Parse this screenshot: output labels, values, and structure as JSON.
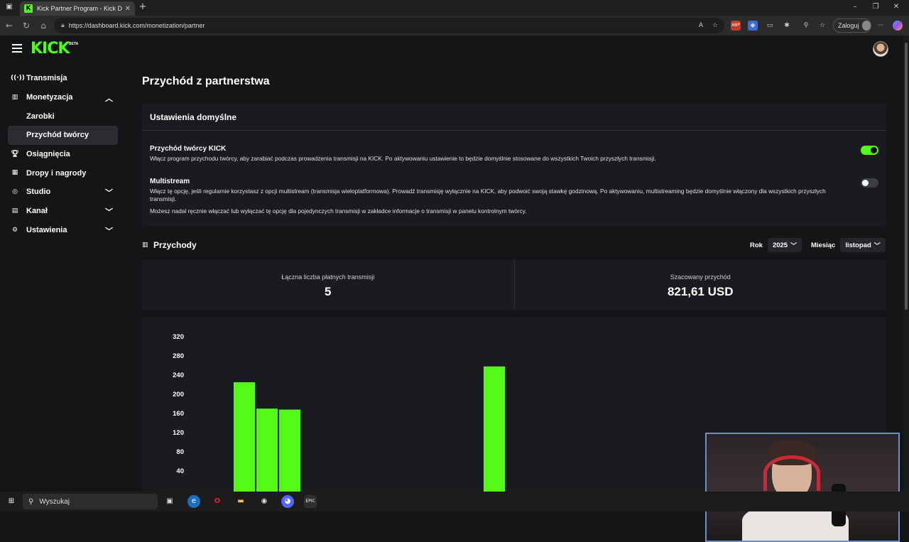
{
  "browser": {
    "tab_title": "Kick Partner Program - Kick Dash",
    "url": "https://dashboard.kick.com/monetization/partner",
    "login_label": "Zaloguj"
  },
  "app": {
    "logo": "KICK",
    "beta": "BETA"
  },
  "sidebar": {
    "items": [
      {
        "label": "Transmisja",
        "icon": "broadcast-icon"
      },
      {
        "label": "Monetyzacja",
        "icon": "chart-icon",
        "expanded": true
      },
      {
        "label": "Osiągnięcia",
        "icon": "trophy-icon"
      },
      {
        "label": "Dropy i nagrody",
        "icon": "gift-icon"
      },
      {
        "label": "Studio",
        "icon": "studio-icon"
      },
      {
        "label": "Kanał",
        "icon": "channel-icon"
      },
      {
        "label": "Ustawienia",
        "icon": "gear-icon"
      }
    ],
    "sub_items": [
      {
        "label": "Zarobki"
      },
      {
        "label": "Przychód twórcy",
        "active": true
      }
    ]
  },
  "main": {
    "title": "Przychód z partnerstwa",
    "settings_card": {
      "header": "Ustawienia domyślne",
      "creator_revenue": {
        "title": "Przychód twórcy KICK",
        "desc": "Włącz program przychodu twórcy, aby zarabiać podczas prowadzenia transmisji na KICK. Po aktywowaniu ustawienie to będzie domyślnie stosowane do wszystkich Twoich przyszłych transmisji.",
        "enabled": true
      },
      "multistream": {
        "title": "Multistream",
        "desc": "Włącz tę opcję, jeśli regularnie korzystasz z opcji multistream (transmisja wieloplatformowa). Prowadź transmisję wyłącznie na KICK, aby podwoić swoją stawkę godzinową. Po aktywowaniu, multistreaming będzie domyślnie włączony dla wszystkich przyszłych transmisji.",
        "note": "Możesz nadal ręcznie włączać lub wyłączać tę opcję dla pojedynczych transmisji w zakładce informacje o transmisji w panelu kontrolnym twórcy.",
        "enabled": false
      }
    },
    "revenue": {
      "title": "Przychody",
      "year_label": "Rok",
      "year_value": "2025",
      "month_label": "Miesiąc",
      "month_value": "listopad",
      "total_streams_label": "Łączna liczba płatnych transmisji",
      "total_streams_value": "5",
      "estimated_label": "Szacowany przychód",
      "estimated_value": "821,61 USD"
    }
  },
  "chart_data": {
    "type": "bar",
    "y_ticks": [
      "40",
      "80",
      "120",
      "160",
      "200",
      "240",
      "280",
      "320"
    ],
    "ylim": [
      0,
      320
    ],
    "values": [
      225,
      170,
      168,
      0,
      0,
      0,
      0,
      0,
      0,
      0,
      0,
      258
    ],
    "bar_color": "#53fc18"
  },
  "taskbar": {
    "search_placeholder": "Wyszukaj"
  },
  "colors": {
    "accent": "#53fc18",
    "background": "#141517",
    "card": "#191b1e"
  }
}
